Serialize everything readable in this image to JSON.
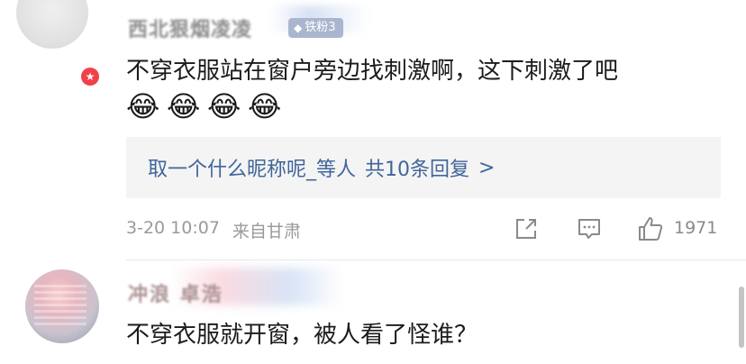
{
  "comments": [
    {
      "username": "西北狠烟凌凌",
      "fan_badge": "铁粉3",
      "text": "不穿衣服站在窗户旁边找刺激啊，这下刺激了吧",
      "emojis": [
        "😂",
        "😂",
        "😂",
        "😂"
      ],
      "reply_preview": {
        "user": "取一个什么昵称呢_等人",
        "count_text": "共10条回复",
        "chevron": ">"
      },
      "time": "3-20 10:07",
      "location": "来自甘肃",
      "likes": "1971",
      "verified_icon": "star-badge-icon"
    },
    {
      "username": "冲浪 卓浩",
      "text": "不穿衣服就开窗，被人看了怪谁？"
    }
  ]
}
